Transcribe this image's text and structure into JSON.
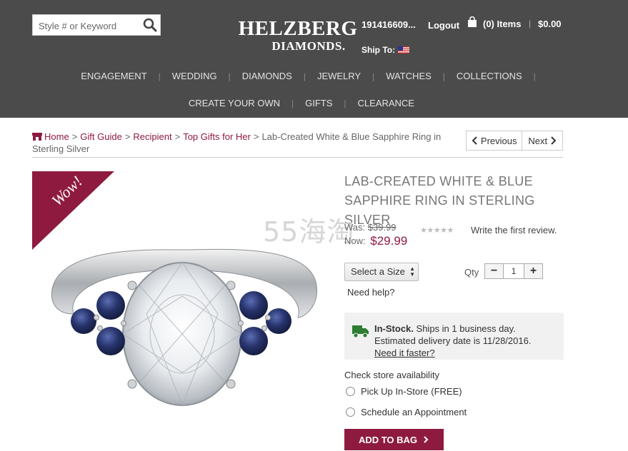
{
  "header": {
    "search_placeholder": "Style # or Keyword",
    "logo_line1": "HELZBERG",
    "logo_line2": "DIAMONDS.",
    "account_number": "191416609...",
    "logout_label": "Logout",
    "cart_label": "(0) Items",
    "cart_separator": "|",
    "cart_total": "$0.00",
    "ship_to_label": "Ship To:"
  },
  "nav": {
    "row1": [
      "ENGAGEMENT",
      "WEDDING",
      "DIAMONDS",
      "JEWELRY",
      "WATCHES",
      "COLLECTIONS"
    ],
    "row2": [
      "CREATE YOUR OWN",
      "GIFTS",
      "CLEARANCE"
    ],
    "separator": "|"
  },
  "breadcrumb": {
    "items": [
      "Home",
      "Gift Guide",
      "Recipient",
      "Top Gifts for Her"
    ],
    "separator": ">",
    "current": "Lab-Created White & Blue Sapphire Ring in Sterling Silver"
  },
  "pager": {
    "previous_label": "Previous",
    "next_label": "Next"
  },
  "product": {
    "badge_text": "Wow!",
    "title": "LAB-CREATED WHITE & BLUE SAPPHIRE RING IN STERLING SILVER",
    "watermark": "55海淘",
    "was_label": "Was:",
    "was_price": "$39.99",
    "now_label": "Now:",
    "now_price": "$29.99",
    "rating_stars": "★★★★★",
    "rating_value": 0,
    "review_link": "Write the first review.",
    "size_select": "Select a Size",
    "qty_label": "Qty",
    "qty_minus": "−",
    "qty_value": "1",
    "qty_plus": "+",
    "help_link": "Need help?",
    "stock_status": "In-Stock.",
    "stock_ship": "Ships in 1 business day.",
    "delivery": "Estimated delivery date is 11/28/2016.",
    "faster_link": "Need it faster?",
    "store_heading": "Check store availability",
    "option_pickup": "Pick Up In-Store (FREE)",
    "option_appointment": "Schedule an Appointment",
    "add_to_bag": "ADD TO BAG"
  },
  "colors": {
    "header_bg": "#4b4b4b",
    "accent": "#8e1b3f",
    "stock_green": "#2e7d32"
  }
}
